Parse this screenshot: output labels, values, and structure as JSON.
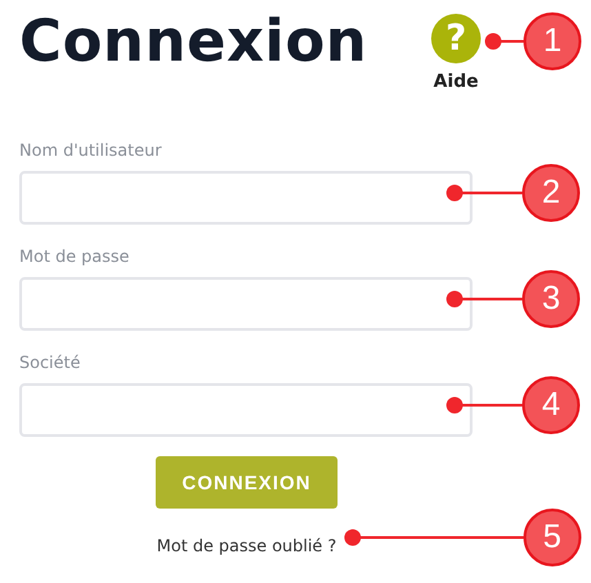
{
  "title": "Connexion",
  "help": {
    "icon": "?",
    "label": "Aide",
    "callout": "1"
  },
  "fields": [
    {
      "label": "Nom d'utilisateur",
      "callout": "2"
    },
    {
      "label": "Mot de passe",
      "callout": "3"
    },
    {
      "label": "Société",
      "callout": "4"
    }
  ],
  "button": {
    "label": "CONNEXION"
  },
  "forgot": {
    "label": "Mot de passe oublié ?",
    "callout": "5"
  }
}
